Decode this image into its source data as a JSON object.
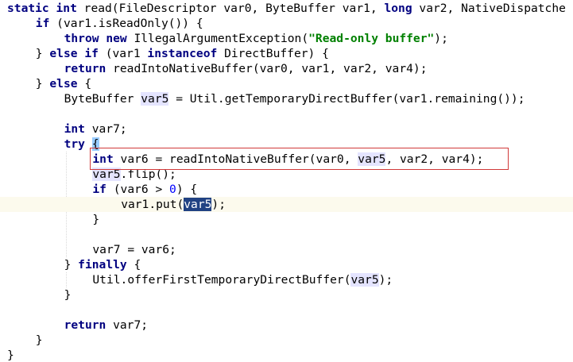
{
  "editor": {
    "lines": [
      {
        "indent": 0,
        "tokens": [
          {
            "t": "static",
            "c": "kw"
          },
          {
            "t": " "
          },
          {
            "t": "int",
            "c": "kw"
          },
          {
            "t": " read(FileDescriptor var0, ByteBuffer var1, "
          },
          {
            "t": "long",
            "c": "kw"
          },
          {
            "t": " var2, NativeDispatche"
          }
        ]
      },
      {
        "indent": 1,
        "tokens": [
          {
            "t": "if",
            "c": "kw"
          },
          {
            "t": " (var1.isReadOnly()) {"
          }
        ]
      },
      {
        "indent": 2,
        "tokens": [
          {
            "t": "throw",
            "c": "kw"
          },
          {
            "t": " "
          },
          {
            "t": "new",
            "c": "kw"
          },
          {
            "t": " IllegalArgumentException("
          },
          {
            "t": "\"Read-only buffer\"",
            "c": "str"
          },
          {
            "t": ");"
          }
        ]
      },
      {
        "indent": 1,
        "tokens": [
          {
            "t": "} "
          },
          {
            "t": "else",
            "c": "kw"
          },
          {
            "t": " "
          },
          {
            "t": "if",
            "c": "kw"
          },
          {
            "t": " (var1 "
          },
          {
            "t": "instanceof",
            "c": "kw"
          },
          {
            "t": " DirectBuffer) {"
          }
        ]
      },
      {
        "indent": 2,
        "tokens": [
          {
            "t": "return",
            "c": "kw"
          },
          {
            "t": " readIntoNativeBuffer(var0, var1, var2, var4);"
          }
        ]
      },
      {
        "indent": 1,
        "tokens": [
          {
            "t": "} "
          },
          {
            "t": "else",
            "c": "kw"
          },
          {
            "t": " {"
          }
        ]
      },
      {
        "indent": 2,
        "tokens": [
          {
            "t": "ByteBuffer "
          },
          {
            "t": "var5",
            "c": "ref"
          },
          {
            "t": " = Util.getTemporaryDirectBuffer(var1.remaining());"
          }
        ]
      },
      {
        "indent": 0,
        "tokens": []
      },
      {
        "indent": 2,
        "tokens": [
          {
            "t": "int",
            "c": "kw"
          },
          {
            "t": " var7;"
          }
        ]
      },
      {
        "indent": 2,
        "tokens": [
          {
            "t": "try",
            "c": "kw"
          },
          {
            "t": " "
          },
          {
            "t": "{",
            "c": "brace-match"
          }
        ]
      },
      {
        "indent": 3,
        "tokens": [
          {
            "t": "int",
            "c": "kw"
          },
          {
            "t": " var6 = readIntoNativeBuffer(var0, "
          },
          {
            "t": "var5",
            "c": "ref"
          },
          {
            "t": ", var2, var4);"
          }
        ]
      },
      {
        "indent": 3,
        "tokens": [
          {
            "t": "var5",
            "c": "ref"
          },
          {
            "t": ".flip();"
          }
        ]
      },
      {
        "indent": 3,
        "tokens": [
          {
            "t": "if",
            "c": "kw"
          },
          {
            "t": " (var6 > "
          },
          {
            "t": "0",
            "c": "num"
          },
          {
            "t": ") {"
          }
        ]
      },
      {
        "indent": 4,
        "current": true,
        "tokens": [
          {
            "t": "var1.put("
          },
          {
            "t": "var5",
            "c": "ref-sel"
          },
          {
            "t": ");"
          }
        ]
      },
      {
        "indent": 3,
        "tokens": [
          {
            "t": "}"
          }
        ]
      },
      {
        "indent": 0,
        "tokens": []
      },
      {
        "indent": 3,
        "tokens": [
          {
            "t": "var7 = var6;"
          }
        ]
      },
      {
        "indent": 2,
        "tokens": [
          {
            "t": "} "
          },
          {
            "t": "finally",
            "c": "kw"
          },
          {
            "t": " {"
          }
        ]
      },
      {
        "indent": 3,
        "tokens": [
          {
            "t": "Util.offerFirstTemporaryDirectBuffer("
          },
          {
            "t": "var5",
            "c": "ref"
          },
          {
            "t": ");"
          }
        ]
      },
      {
        "indent": 2,
        "tokens": [
          {
            "t": "}"
          }
        ]
      },
      {
        "indent": 0,
        "tokens": []
      },
      {
        "indent": 2,
        "tokens": [
          {
            "t": "return",
            "c": "kw"
          },
          {
            "t": " var7;"
          }
        ]
      },
      {
        "indent": 1,
        "tokens": [
          {
            "t": "}"
          }
        ]
      },
      {
        "indent": 0,
        "tokens": [
          {
            "t": "}"
          }
        ]
      }
    ]
  },
  "colors": {
    "keyword": "#000080",
    "string": "#008000",
    "number": "#0000ff",
    "reference_highlight": "#e4e4ff",
    "selection": "#214283",
    "current_line": "#fcfaed",
    "annotation_box": "#d13a3a"
  }
}
